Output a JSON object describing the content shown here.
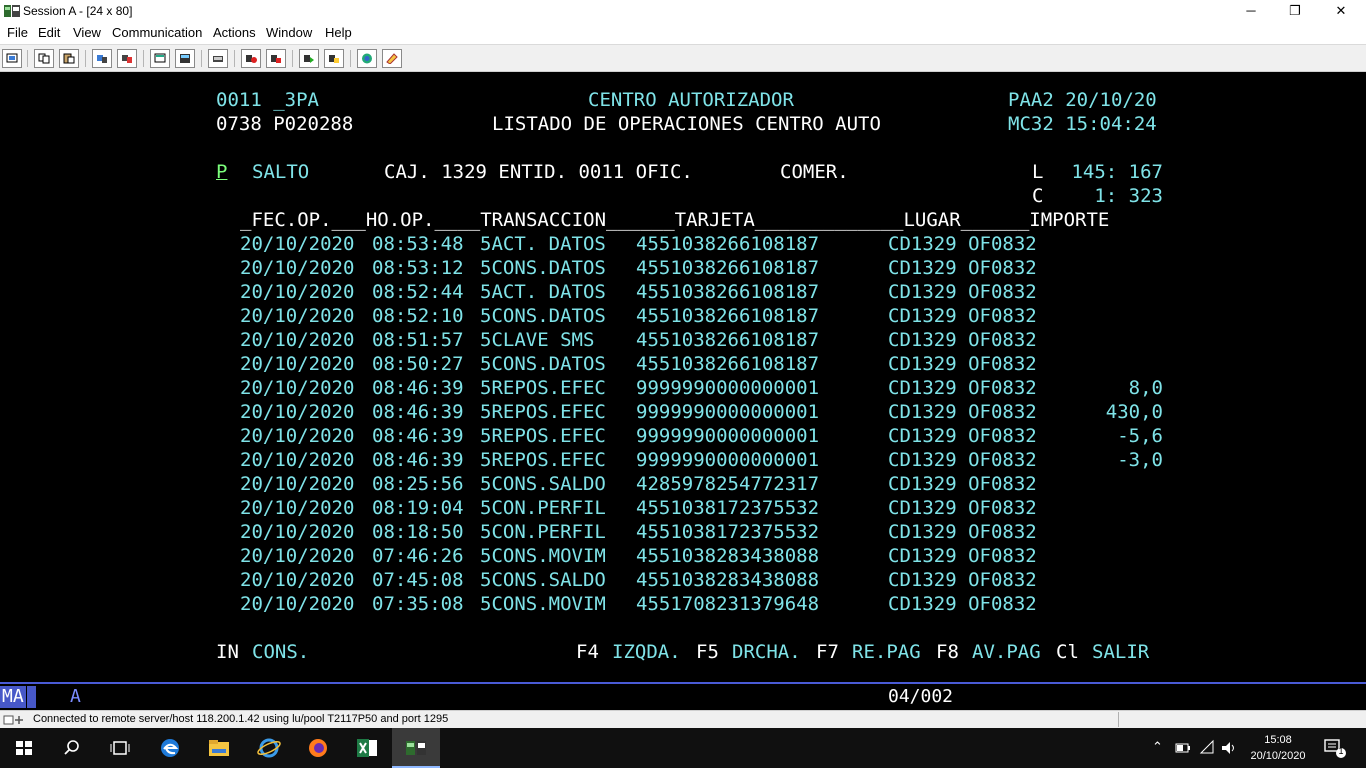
{
  "window": {
    "title": "Session A - [24 x 80]",
    "controls": {
      "minimize": "─",
      "maximize": "❐",
      "close": "✕"
    }
  },
  "menu": [
    "File",
    "Edit",
    "View",
    "Communication",
    "Actions",
    "Window",
    "Help"
  ],
  "toolbar": [
    "print-screen-icon",
    "copy-icon",
    "paste-icon",
    "send-file-icon",
    "receive-file-icon",
    "display-setup-icon",
    "keypad-icon",
    "color-map-icon",
    "record-macro-icon",
    "stop-macro-icon",
    "play-macro-icon",
    "macro-list-icon",
    "support-icon",
    "help-tag-icon"
  ],
  "screen": {
    "header": {
      "r1_left": "0011 _3PA",
      "r1_center": "CENTRO AUTORIZADOR",
      "r1_right": "PAA2 20/10/20",
      "r2_left": "0738 P020288",
      "r2_center": "LISTADO DE OPERACIONES CENTRO AUTO",
      "r2_right": "MC32 15:04:24"
    },
    "filter": {
      "p_field": "P",
      "salto": "SALTO",
      "caj": "CAJ. 1329 ENTID. 0011 OFIC.",
      "comer": "COMER.",
      "l_label": "L",
      "l_value": "145: 167",
      "c_label": "C",
      "c_value": "1: 323"
    },
    "columns_line": "_FEC.OP.___HO.OP.____TRANSACCION______TARJETA_____________LUGAR______IMPORTE",
    "rows": [
      {
        "fecha": "20/10/2020",
        "hora": "08:53:48",
        "transaccion": "5ACT. DATOS",
        "tarjeta": "4551038266108187",
        "lugar": "CD1329 OF0832",
        "importe": ""
      },
      {
        "fecha": "20/10/2020",
        "hora": "08:53:12",
        "transaccion": "5CONS.DATOS",
        "tarjeta": "4551038266108187",
        "lugar": "CD1329 OF0832",
        "importe": ""
      },
      {
        "fecha": "20/10/2020",
        "hora": "08:52:44",
        "transaccion": "5ACT. DATOS",
        "tarjeta": "4551038266108187",
        "lugar": "CD1329 OF0832",
        "importe": ""
      },
      {
        "fecha": "20/10/2020",
        "hora": "08:52:10",
        "transaccion": "5CONS.DATOS",
        "tarjeta": "4551038266108187",
        "lugar": "CD1329 OF0832",
        "importe": ""
      },
      {
        "fecha": "20/10/2020",
        "hora": "08:51:57",
        "transaccion": "5CLAVE SMS",
        "tarjeta": "4551038266108187",
        "lugar": "CD1329 OF0832",
        "importe": ""
      },
      {
        "fecha": "20/10/2020",
        "hora": "08:50:27",
        "transaccion": "5CONS.DATOS",
        "tarjeta": "4551038266108187",
        "lugar": "CD1329 OF0832",
        "importe": ""
      },
      {
        "fecha": "20/10/2020",
        "hora": "08:46:39",
        "transaccion": "5REPOS.EFEC",
        "tarjeta": "9999990000000001",
        "lugar": "CD1329 OF0832",
        "importe": "8,0"
      },
      {
        "fecha": "20/10/2020",
        "hora": "08:46:39",
        "transaccion": "5REPOS.EFEC",
        "tarjeta": "9999990000000001",
        "lugar": "CD1329 OF0832",
        "importe": "430,0"
      },
      {
        "fecha": "20/10/2020",
        "hora": "08:46:39",
        "transaccion": "5REPOS.EFEC",
        "tarjeta": "9999990000000001",
        "lugar": "CD1329 OF0832",
        "importe": "-5,6"
      },
      {
        "fecha": "20/10/2020",
        "hora": "08:46:39",
        "transaccion": "5REPOS.EFEC",
        "tarjeta": "9999990000000001",
        "lugar": "CD1329 OF0832",
        "importe": "-3,0"
      },
      {
        "fecha": "20/10/2020",
        "hora": "08:25:56",
        "transaccion": "5CONS.SALDO",
        "tarjeta": "4285978254772317",
        "lugar": "CD1329 OF0832",
        "importe": ""
      },
      {
        "fecha": "20/10/2020",
        "hora": "08:19:04",
        "transaccion": "5CON.PERFIL",
        "tarjeta": "4551038172375532",
        "lugar": "CD1329 OF0832",
        "importe": ""
      },
      {
        "fecha": "20/10/2020",
        "hora": "08:18:50",
        "transaccion": "5CON.PERFIL",
        "tarjeta": "4551038172375532",
        "lugar": "CD1329 OF0832",
        "importe": ""
      },
      {
        "fecha": "20/10/2020",
        "hora": "07:46:26",
        "transaccion": "5CONS.MOVIM",
        "tarjeta": "4551038283438088",
        "lugar": "CD1329 OF0832",
        "importe": ""
      },
      {
        "fecha": "20/10/2020",
        "hora": "07:45:08",
        "transaccion": "5CONS.SALDO",
        "tarjeta": "4551038283438088",
        "lugar": "CD1329 OF0832",
        "importe": ""
      },
      {
        "fecha": "20/10/2020",
        "hora": "07:35:08",
        "transaccion": "5CONS.MOVIM",
        "tarjeta": "4551708231379648",
        "lugar": "CD1329 OF0832",
        "importe": ""
      }
    ],
    "footer": {
      "in_label": "IN",
      "in_value": "CONS.",
      "keys": [
        {
          "key": "F4",
          "action": "IZQDA."
        },
        {
          "key": "F5",
          "action": "DRCHA."
        },
        {
          "key": "F7",
          "action": "RE.PAG"
        },
        {
          "key": "F8",
          "action": "AV.PAG"
        },
        {
          "key": "Cl",
          "action": "SALIR"
        }
      ]
    }
  },
  "oia": {
    "mode": "MA",
    "indicator": "A",
    "position": "04/002"
  },
  "status": {
    "message": "Connected to remote server/host 118.200.1.42 using lu/pool T2117P50 and port 1295"
  },
  "taskbar": {
    "items": [
      "windows-start-icon",
      "search-icon",
      "task-view-icon",
      "edge-icon",
      "file-explorer-icon",
      "internet-explorer-icon",
      "firefox-icon",
      "excel-icon",
      "pcomm-session-icon"
    ],
    "time": "15:08",
    "date": "20/10/2020",
    "notifications": "1"
  },
  "colors": {
    "terminal_text": "#7fe3e8",
    "terminal_bg": "#000000",
    "oia_accent": "#4758c8"
  }
}
